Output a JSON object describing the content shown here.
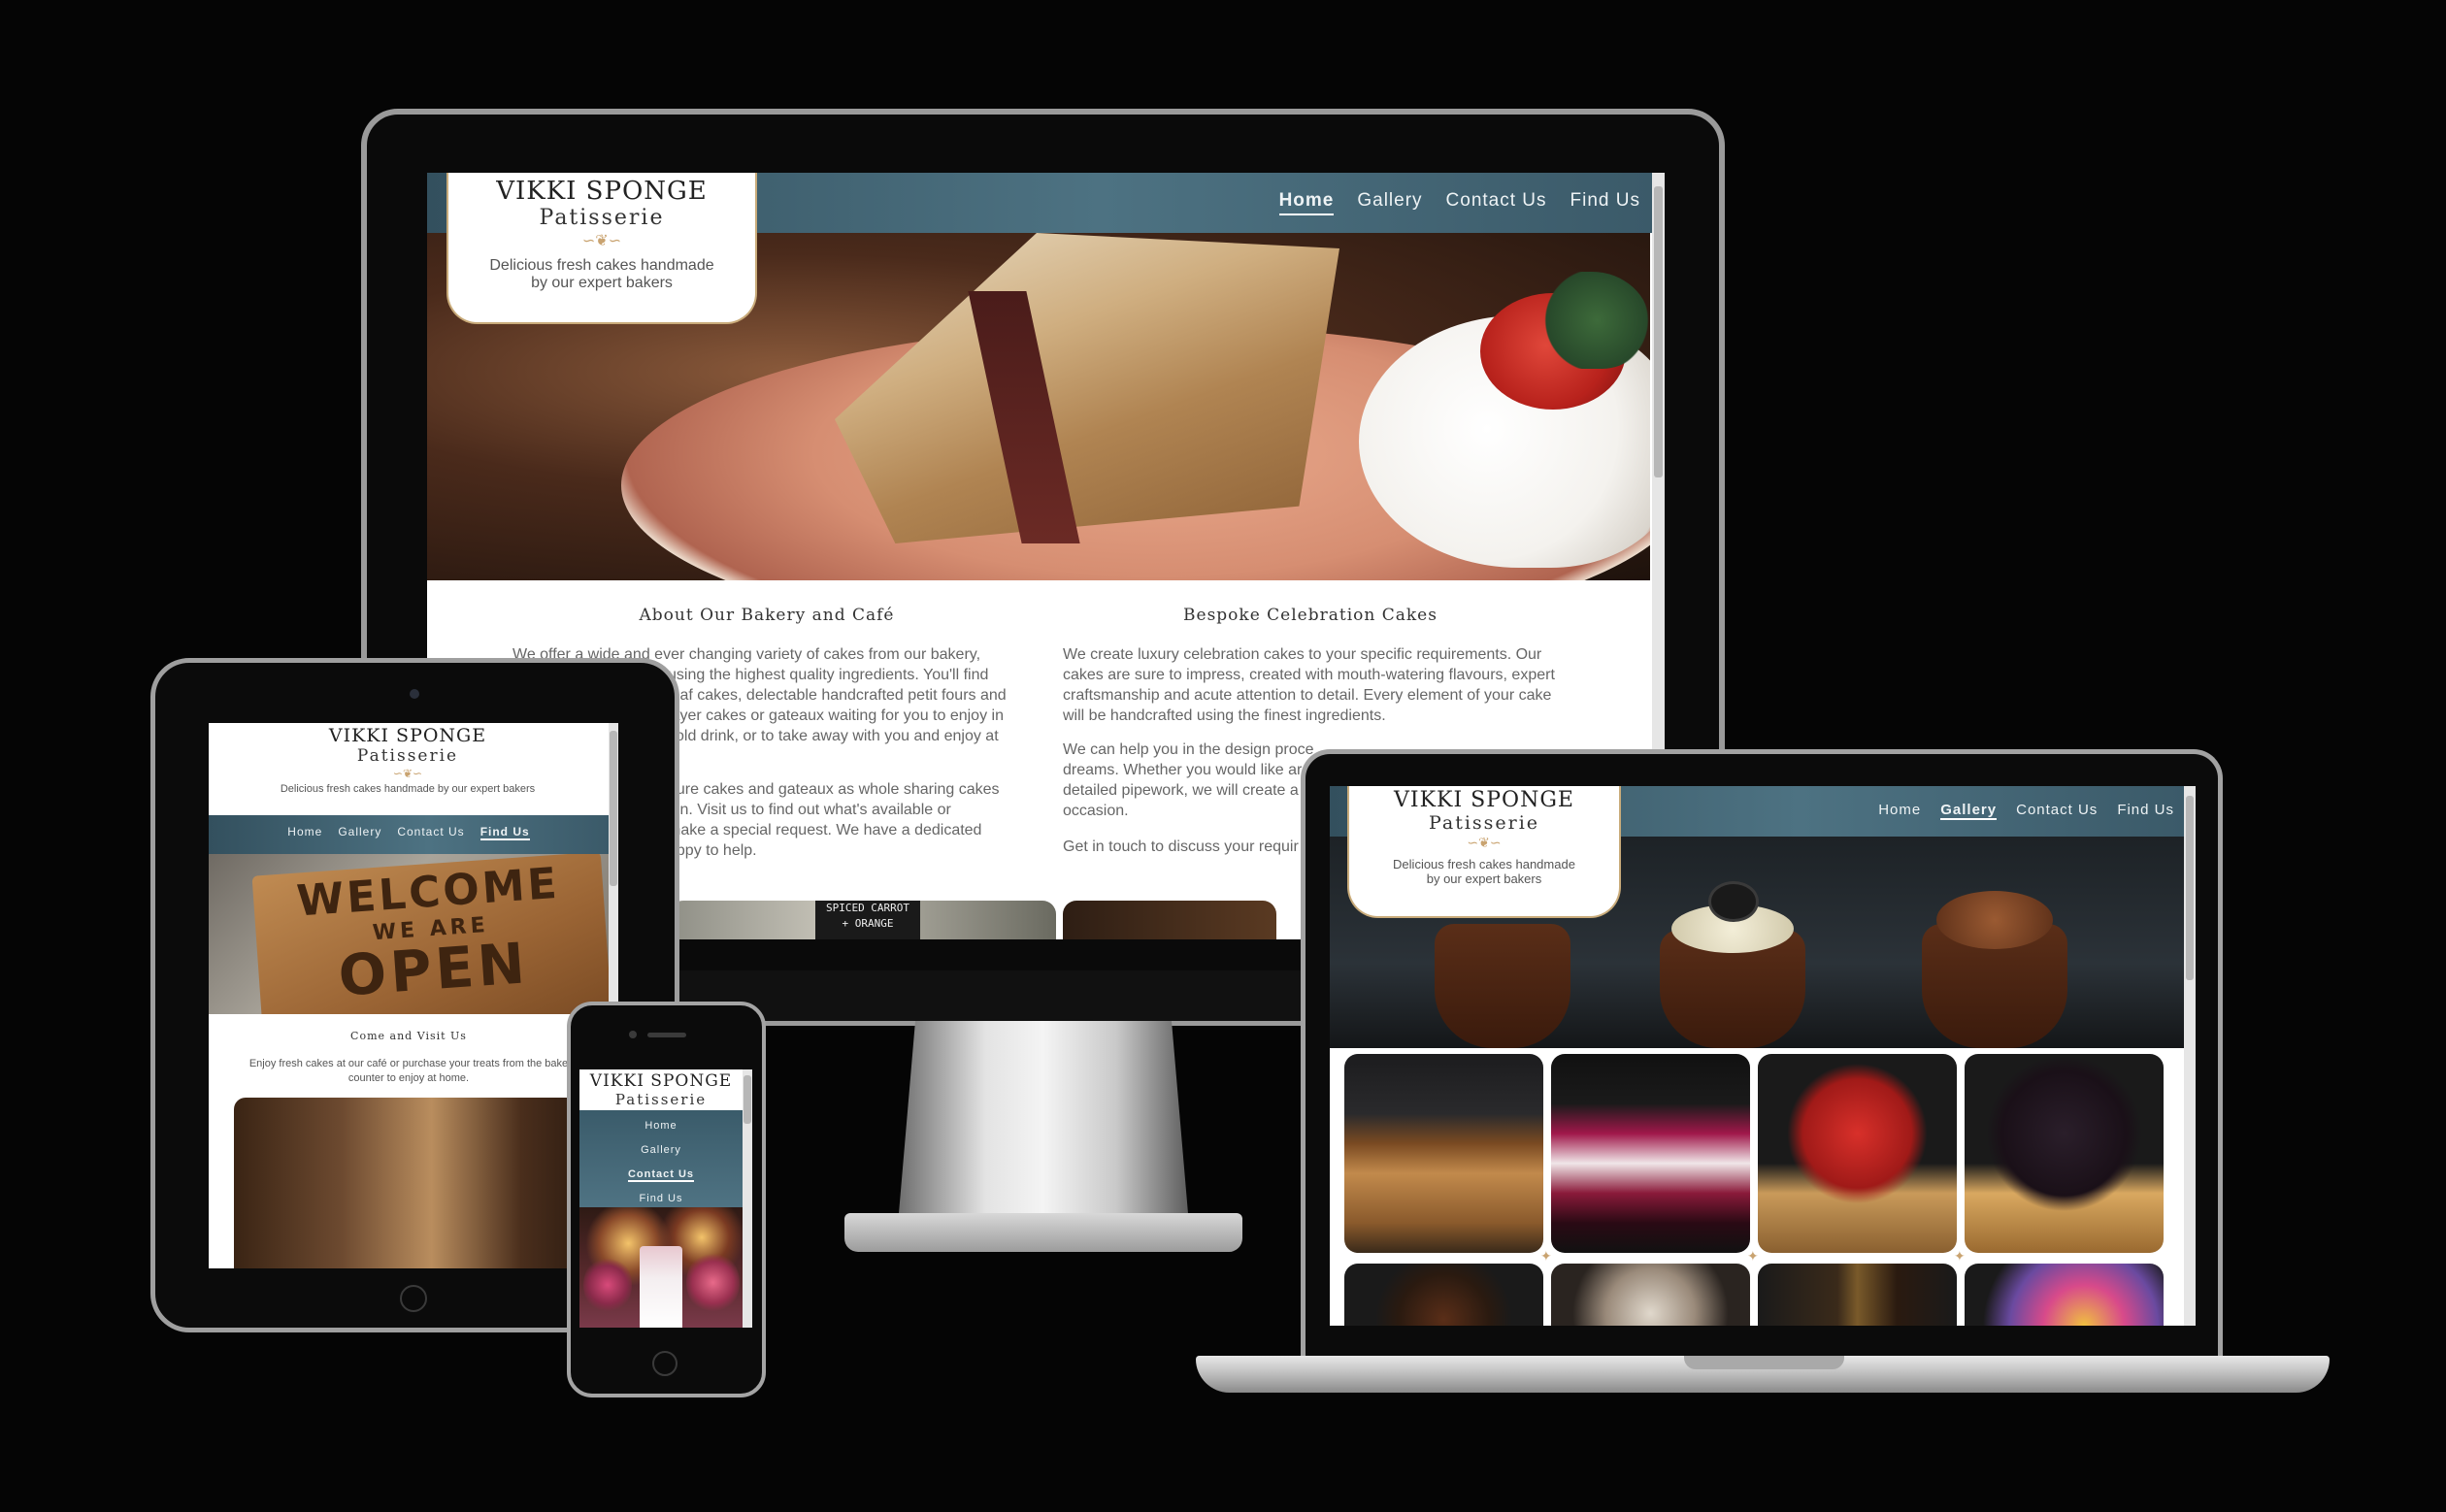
{
  "desktop": {
    "brand": {
      "title": "VIKKI SPONGE",
      "subtitle": "Patisserie",
      "tagline_line1": "Delicious fresh cakes handmade",
      "tagline_line2": "by our expert bakers"
    },
    "nav": [
      "Home",
      "Gallery",
      "Contact Us",
      "Find Us"
    ],
    "about": {
      "heading": "About Our Bakery and Café",
      "lines1": [
        "We offer a wide and ever changing variety of cakes from our bakery,",
        "using the highest quality ingredients. You'll find",
        "loaf cakes, delectable handcrafted petit fours and",
        "layer cakes or gateaux waiting for you to enjoy in",
        "cold drink, or to take away with you and enjoy at"
      ],
      "lines2": [
        "hure cakes and gateaux as whole sharing cakes",
        "ion. Visit us to find out what's available or",
        "make a special request. We have a dedicated",
        "appy to help."
      ]
    },
    "bespoke": {
      "heading": "Bespoke Celebration Cakes",
      "lines1": [
        "We create luxury celebration cakes to your specific requirements. Our",
        "cakes are sure to impress, created with mouth-watering flavours, expert",
        "craftsmanship and acute attention to detail. Every element of your cake",
        "will be handcrafted using the finest ingredients."
      ],
      "lines2": [
        "We can help you in the design proce",
        "dreams. Whether you would like ar",
        "detailed pipework, we will create a",
        "occasion."
      ],
      "cta": "Get in touch to discuss your requir"
    },
    "chalk_sign": [
      "SPICED CARROT",
      "+ ORANGE"
    ]
  },
  "tablet": {
    "brand": {
      "title": "VIKKI SPONGE",
      "subtitle": "Patisserie",
      "tagline": "Delicious fresh cakes handmade by our expert bakers"
    },
    "nav": [
      "Home",
      "Gallery",
      "Contact Us",
      "Find Us"
    ],
    "sign": {
      "line1": "WELCOME",
      "line2": "WE ARE",
      "line3": "OPEN"
    },
    "visit": {
      "heading": "Come and Visit Us",
      "line1": "Enjoy fresh cakes at our café or purchase your treats from the bake",
      "line2": "counter to enjoy at home."
    }
  },
  "phone": {
    "brand": {
      "title": "VIKKI SPONGE",
      "subtitle": "Patisserie"
    },
    "nav": [
      "Home",
      "Gallery",
      "Contact Us",
      "Find Us"
    ]
  },
  "laptop": {
    "brand": {
      "title": "VIKKI SPONGE",
      "subtitle": "Patisserie",
      "tagline_line1": "Delicious fresh cakes handmade",
      "tagline_line2": "by our expert bakers"
    },
    "nav": [
      "Home",
      "Gallery",
      "Contact Us",
      "Find Us"
    ]
  },
  "active": {
    "desktop": "Home",
    "tablet": "Find Us",
    "phone": "Contact Us",
    "laptop": "Gallery"
  },
  "colors": {
    "nav_bar": "#3d5f6e",
    "accent_gold": "#c9a370",
    "background": "#050505"
  }
}
